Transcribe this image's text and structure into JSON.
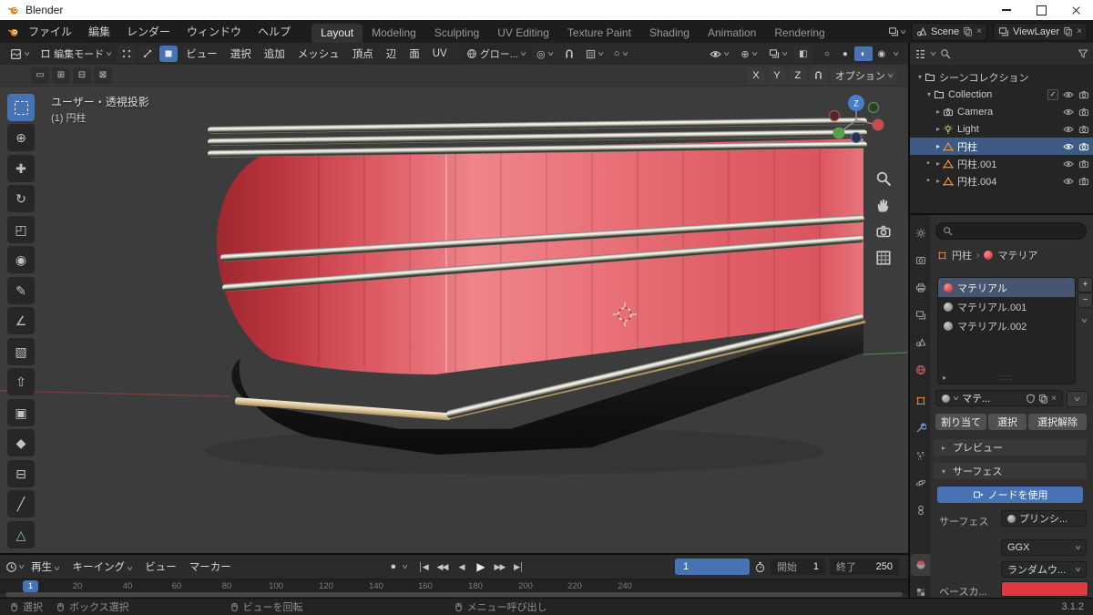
{
  "theme": {
    "accent": "#4772b3"
  },
  "icons": {
    "chevron": "∨",
    "tri_right": "▸",
    "tri_down": "▾",
    "close": "×",
    "check": "✓",
    "plus": "+",
    "minus": "−",
    "record": "●",
    "dot": "•",
    "grip": "::::",
    "breadcrumb_sep": "›"
  },
  "titlebar": {
    "app_title": "Blender"
  },
  "topbar": {
    "menus": [
      "ファイル",
      "編集",
      "レンダー",
      "ウィンドウ",
      "ヘルプ"
    ],
    "workspaces": [
      "Layout",
      "Modeling",
      "Sculpting",
      "UV Editing",
      "Texture Paint",
      "Shading",
      "Animation",
      "Rendering"
    ],
    "scene_name": "Scene",
    "view_layer_name": "ViewLayer"
  },
  "viewport_header": {
    "mode_label": "編集モード",
    "menus": [
      "ビュー",
      "選択",
      "追加",
      "メッシュ",
      "頂点",
      "辺",
      "面",
      "UV"
    ],
    "orientation_label": "グロー...",
    "axes": [
      "X",
      "Y",
      "Z"
    ],
    "options_label": "オプション"
  },
  "viewport": {
    "projection_label": "ユーザー・透視投影",
    "object_label": "(1) 円柱",
    "gizmo_z": "Z"
  },
  "toolbar": {
    "tools": [
      {
        "name": "select-box",
        "glyph": ""
      },
      {
        "name": "cursor",
        "glyph": "⊕"
      },
      {
        "name": "move",
        "glyph": "✚"
      },
      {
        "name": "rotate",
        "glyph": "↻"
      },
      {
        "name": "scale",
        "glyph": "◰"
      },
      {
        "name": "transform",
        "glyph": "◉"
      },
      {
        "name": "annotate",
        "glyph": "✎"
      },
      {
        "name": "measure",
        "glyph": "∠"
      },
      {
        "name": "add-cube",
        "glyph": "▧"
      },
      {
        "name": "extrude",
        "glyph": "⇧"
      },
      {
        "name": "inset",
        "glyph": "▣"
      },
      {
        "name": "bevel",
        "glyph": "◆"
      },
      {
        "name": "loop-cut",
        "glyph": "⊟"
      },
      {
        "name": "knife",
        "glyph": "╱"
      },
      {
        "name": "poly-build",
        "glyph": "△"
      }
    ]
  },
  "outliner": {
    "rows": [
      {
        "label": "シーンコレクション"
      },
      {
        "label": "Collection"
      },
      {
        "label": "Camera"
      },
      {
        "label": "Light"
      },
      {
        "label": "円柱"
      },
      {
        "label": "円柱.001"
      },
      {
        "label": "円柱.004"
      }
    ]
  },
  "properties": {
    "breadcrumb_object": "円柱",
    "breadcrumb_material": "マテリア",
    "slots": [
      {
        "label": "マテリアル"
      },
      {
        "label": "マテリアル.001"
      },
      {
        "label": "マテリアル.002"
      }
    ],
    "material_name": "マテ...",
    "assign_label": "割り当て",
    "select_label": "選択",
    "deselect_label": "選択解除",
    "preview_label": "プレビュー",
    "surface_panel_label": "サーフェス",
    "use_nodes_label": "ノードを使用",
    "surface_label": "サーフェス",
    "surface_value": "プリンシ...",
    "distribution_value": "GGX",
    "subsurface_method_value": "ランダムウ...",
    "base_color_label": "ベースカ...",
    "base_color": "#dc3a40"
  },
  "timeline": {
    "menus": [
      "再生",
      "キーイング",
      "ビュー",
      "マーカー"
    ],
    "transport": [
      "│◀",
      "◀◀",
      "◀",
      "▶",
      "▶▶",
      "▶│"
    ],
    "current_frame": "1",
    "frame_start_label": "開始",
    "frame_start": "1",
    "frame_end_label": "終了",
    "frame_end": "250",
    "ticks": [
      "20",
      "40",
      "60",
      "80",
      "100",
      "120",
      "140",
      "160",
      "180",
      "200",
      "220",
      "240"
    ]
  },
  "statusbar": {
    "select_label": "選択",
    "box_select_label": "ボックス選択",
    "rotate_view_label": "ビューを回転",
    "call_menu_label": "メニュー呼び出し",
    "version": "3.1.2"
  }
}
